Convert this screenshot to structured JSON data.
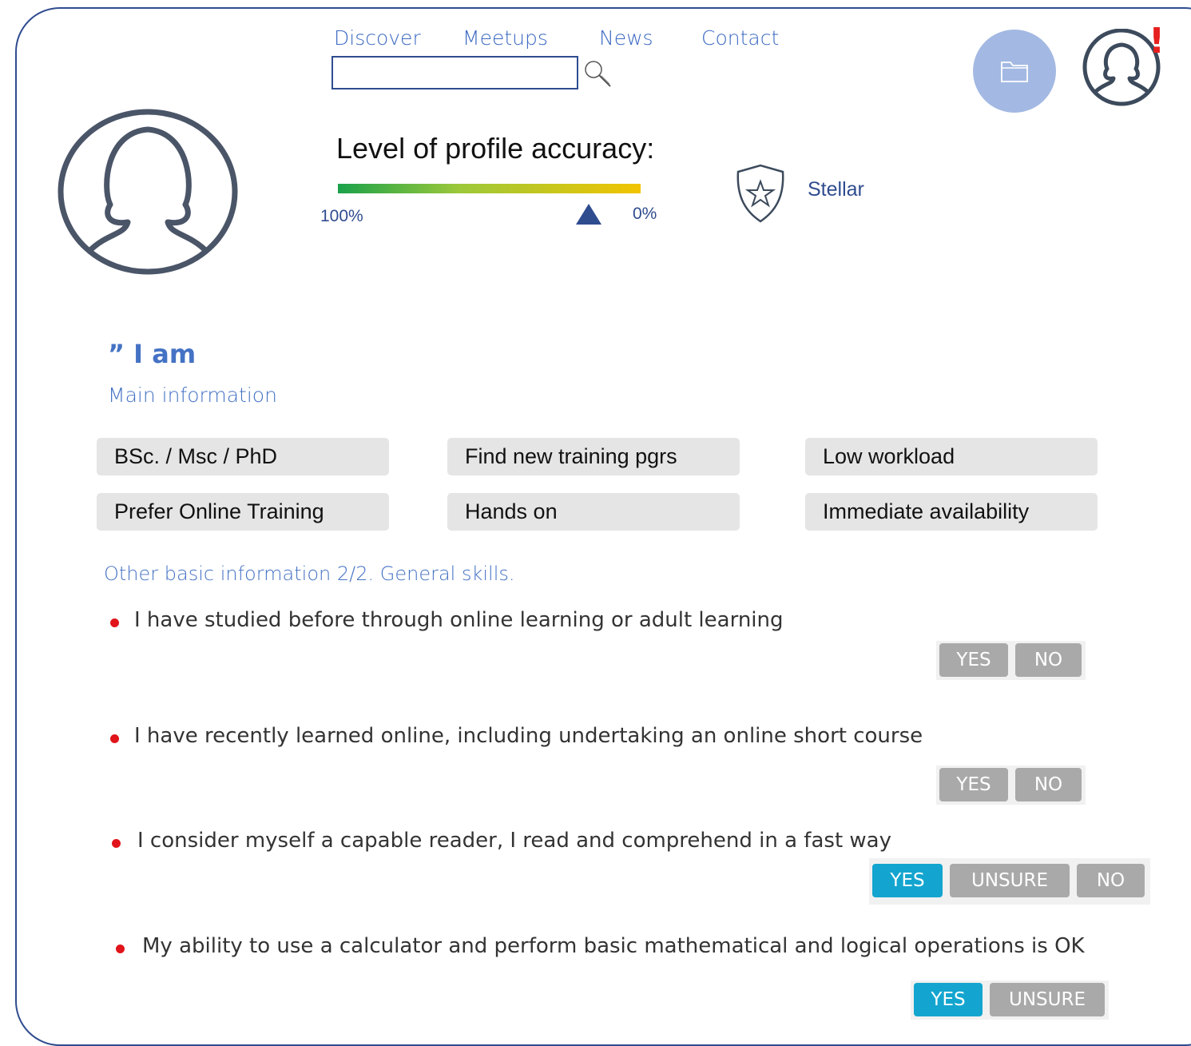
{
  "nav": {
    "links": [
      "Discover",
      "Meetups",
      "News",
      "Contact"
    ],
    "search_placeholder": ""
  },
  "header": {
    "alert_mark": "!"
  },
  "profile": {
    "accuracy_label": "Level of profile accuracy:",
    "bar_left_label": "100%",
    "bar_right_label": "0%",
    "accuracy_marker_fraction": 0.84,
    "badge_label": "Stellar"
  },
  "section": {
    "heading": "” I am",
    "subheading": "Main information"
  },
  "tags": [
    "BSc. / Msc / PhD",
    "Find new training pgrs",
    "Low workload",
    "Prefer Online Training",
    "Hands on",
    "Immediate availability"
  ],
  "other": {
    "heading": "Other basic information 2/2. General skills."
  },
  "questions": [
    {
      "text": "I have studied before through online learning or adult learning",
      "options": [
        "YES",
        "NO"
      ],
      "selected": null
    },
    {
      "text": "I have recently learned online, including undertaking an online short course",
      "options": [
        "YES",
        "NO"
      ],
      "selected": null
    },
    {
      "text": "I consider myself a capable reader, I read and comprehend in a fast way",
      "options": [
        "YES",
        "UNSURE",
        "NO"
      ],
      "selected": "YES"
    },
    {
      "text": "My ability to use a calculator and perform basic mathematical and logical operations is OK",
      "options": [
        "YES",
        "UNSURE"
      ],
      "selected": "YES"
    }
  ],
  "colors": {
    "accent": "#4472c4",
    "selected_button": "#13a5cf",
    "unselected_button": "#a9a9a9",
    "bullet": "#e0141a"
  }
}
